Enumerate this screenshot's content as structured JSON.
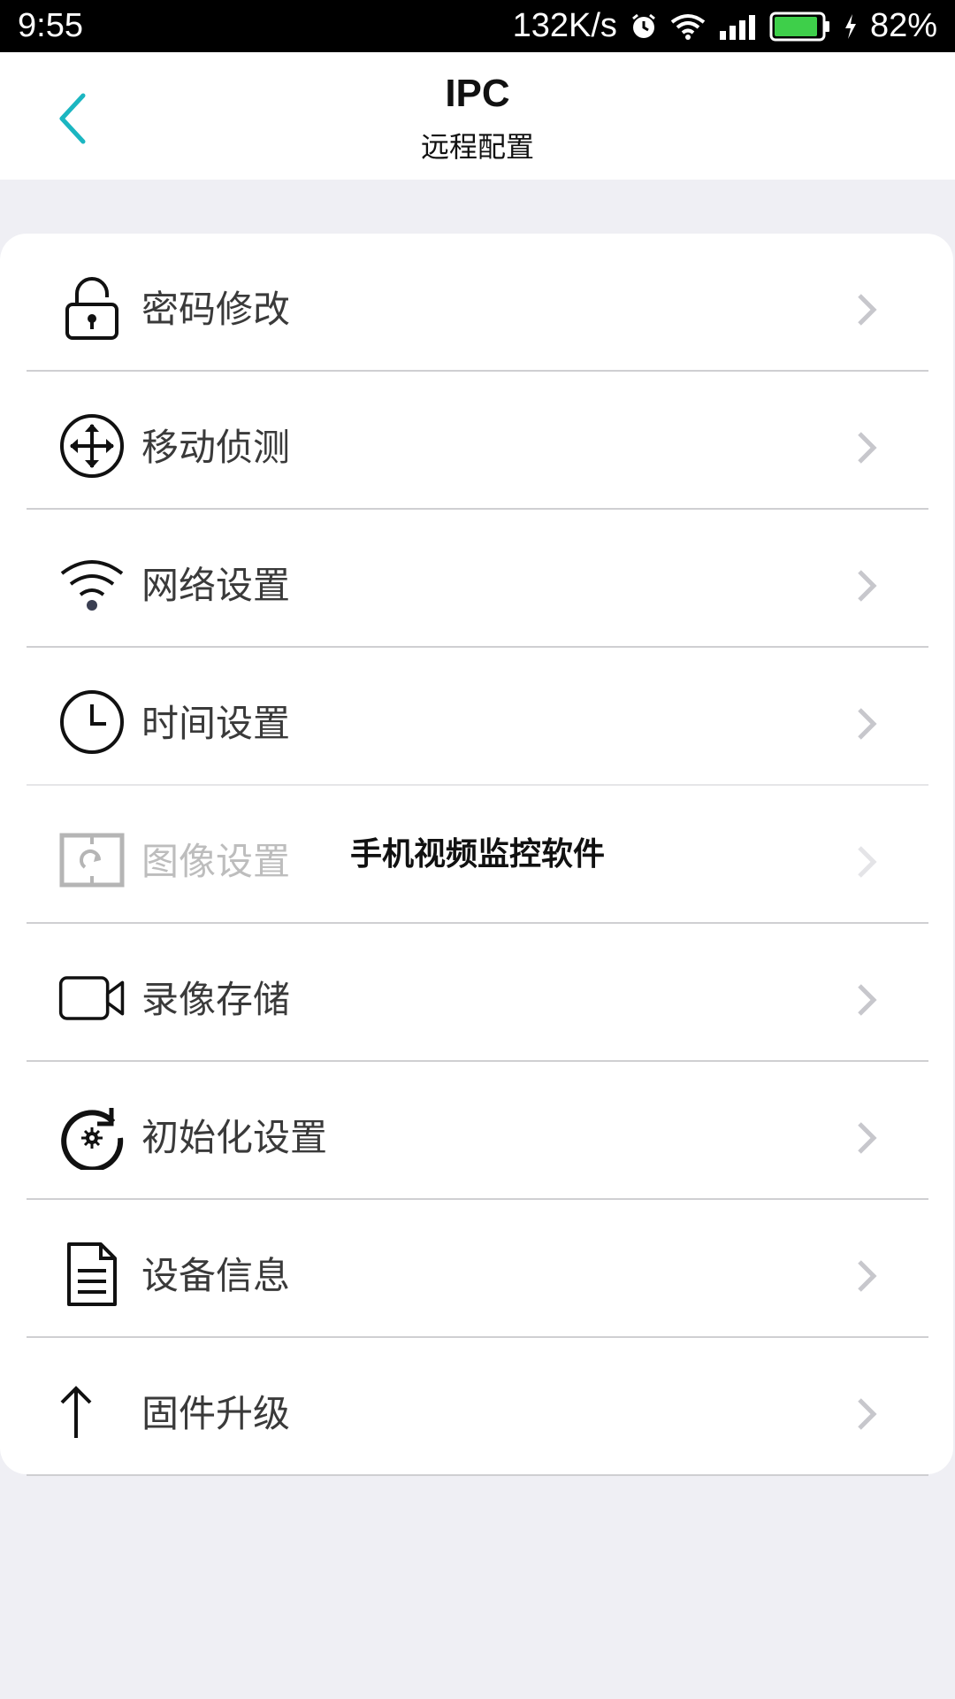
{
  "status_bar": {
    "time": "9:55",
    "speed": "132K/s",
    "battery": "82%",
    "icons": [
      "alarm-icon",
      "wifi-icon",
      "signal-icon",
      "battery-icon",
      "charging-icon"
    ]
  },
  "header": {
    "title": "IPC",
    "subtitle": "远程配置",
    "back_icon": "chevron-left-icon",
    "accent_color": "#1bb6c1"
  },
  "menu": {
    "items": [
      {
        "label": "密码修改",
        "icon": "lock-icon",
        "enabled": true
      },
      {
        "label": "移动侦测",
        "icon": "move-arrows-icon",
        "enabled": true
      },
      {
        "label": "网络设置",
        "icon": "wifi-icon",
        "enabled": true
      },
      {
        "label": "时间设置",
        "icon": "clock-icon",
        "enabled": true
      },
      {
        "label": "图像设置",
        "icon": "image-rotate-icon",
        "enabled": false
      },
      {
        "label": "录像存储",
        "icon": "video-camera-icon",
        "enabled": true
      },
      {
        "label": "初始化设置",
        "icon": "reset-gear-icon",
        "enabled": true
      },
      {
        "label": "设备信息",
        "icon": "document-icon",
        "enabled": true
      },
      {
        "label": "固件升级",
        "icon": "arrow-up-icon",
        "enabled": true
      }
    ]
  },
  "watermark": "手机视频监控软件"
}
